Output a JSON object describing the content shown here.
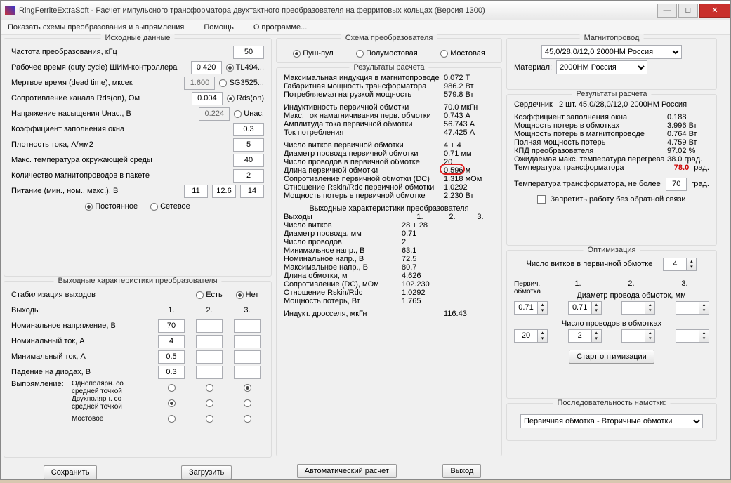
{
  "window": {
    "title": "RingFerriteExtraSoft - Расчет импульсного трансформатора двухтактного преобразователя на ферритовых кольцах (Версия 1300)",
    "min": "—",
    "max": "□",
    "close": "✕"
  },
  "menu": {
    "schemes": "Показать схемы преобразования и выпрямления",
    "help": "Помощь",
    "about": "О программе..."
  },
  "left": {
    "title": "Исходные данные",
    "freq_lbl": "Частота преобразования, кГц",
    "freq": "50",
    "duty_lbl": "Рабочее время (duty cycle) ШИМ-контроллера",
    "duty": "0.420",
    "tl494": "TL494...",
    "dead_lbl": "Мертвое время (dead time), мксек",
    "dead": "1.600",
    "sg": "SG3525...",
    "rds_lbl": "Сопротивление канала Rds(on), Ом",
    "rds": "0.004",
    "rdson": "Rds(on)",
    "usat_lbl": "Напряжение насыщения Uнас., В",
    "usat": "0.224",
    "unasc": "Uнас.",
    "kfill_lbl": "Коэффициент заполнения окна",
    "kfill": "0.3",
    "j_lbl": "Плотность тока, А/мм2",
    "j": "5",
    "tamb_lbl": "Макс. температура окружающей среды",
    "tamb": "40",
    "ncores_lbl": "Количество магнитопроводов в пакете",
    "ncores": "2",
    "supply_lbl": "Питание (мин., ном., макс.), В",
    "vmin": "11",
    "vnom": "12.6",
    "vmax": "14",
    "dc": "Постоянное",
    "ac": "Сетевое",
    "out_title": "Выходные характеристики преобразователя",
    "stab_lbl": "Стабилизация выходов",
    "yes": "Есть",
    "no": "Нет",
    "outs": "Выходы",
    "c1": "1.",
    "c2": "2.",
    "c3": "3.",
    "vn_lbl": "Номинальное напряжение, В",
    "vn1": "70",
    "in_lbl": "Номинальный ток, А",
    "in1": "4",
    "imin_lbl": "Минимальный ток, А",
    "imin1": "0.5",
    "vd_lbl": "Падение на диодах, В",
    "vd1": "0.3",
    "rect_lbl": "Выпрямление:",
    "r1": "Однополярн. со средней точкой",
    "r2": "Двухполярн. со средней точкой",
    "r3": "Мостовое",
    "save": "Сохранить",
    "load": "Загрузить"
  },
  "mid": {
    "conv_title": "Схема преобразователя",
    "push": "Пуш-пул",
    "half": "Полумостовая",
    "full": "Мостовая",
    "res_title": "Результаты расчета",
    "rows1": [
      [
        "Максимальная индукция в магнитопроводе",
        "0.072 Т"
      ],
      [
        "Габаритная мощность трансформатора",
        "986.2 Вт"
      ],
      [
        "Потребляемая нагрузкой мощность",
        "579.8 Вт"
      ]
    ],
    "rows2": [
      [
        "Индуктивность первичной обмотки",
        "70.0 мкГн"
      ],
      [
        "Макс. ток намагничивания перв. обмотки",
        "0.743 А"
      ],
      [
        "Амплитуда тока первичной обмотки",
        "56.743 А"
      ],
      [
        "Ток потребления",
        "47.425 А"
      ]
    ],
    "rows3": [
      [
        "Число витков первичной обмотки",
        "4 + 4"
      ],
      [
        "Диаметр провода первичной обмотки",
        "0.71 мм"
      ],
      [
        "Число проводов в первичной обмотке",
        "20"
      ],
      [
        "Длина первичной обмотки",
        "0.596 м"
      ],
      [
        "Сопротивление первичной обмотки (DC)",
        "1.318 мОм"
      ],
      [
        "Отношение Rskin/Rdc первичной обмотки",
        "1.0292"
      ],
      [
        "Мощность потерь в первичной обмотке",
        "2.230 Вт"
      ]
    ],
    "out_title": "Выходные характеристики преобразователя",
    "outhdr": [
      "Выходы",
      "1.",
      "2.",
      "3."
    ],
    "outrows": [
      [
        "Число витков",
        "28 + 28"
      ],
      [
        "Диаметр провода, мм",
        "0.71"
      ],
      [
        "Число проводов",
        "2"
      ],
      [
        "Минимальное напр., В",
        "63.1"
      ],
      [
        "Номинальное напр., В",
        "72.5"
      ],
      [
        "Максимальное напр., В",
        "80.7"
      ],
      [
        "Длина обмотки, м",
        "4.626"
      ],
      [
        "Сопротивление (DC), мОм",
        "102.230"
      ],
      [
        "Отношение Rskin/Rdc",
        "1.0292"
      ],
      [
        "Мощность потерь, Вт",
        "1.765"
      ]
    ],
    "choke": [
      "Индукт. дросселя, мкГн",
      "116.43"
    ],
    "auto": "Автоматический расчет",
    "exit": "Выход"
  },
  "right": {
    "core_title": "Магнитопровод",
    "core_sel": "45,0/28,0/12,0 2000НМ Россия",
    "mat_lbl": "Материал:",
    "mat_sel": "2000НМ Россия",
    "res_title": "Результаты расчета",
    "core_k": "Сердечник",
    "core_v": "2 шт. 45,0/28,0/12,0 2000НМ Россия",
    "rows": [
      [
        "Коэффициент заполнения окна",
        "0.188"
      ],
      [
        "Мощность потерь в обмотках",
        "3.996 Вт"
      ],
      [
        "Мощность потерь в магнитопроводе",
        "0.764 Вт"
      ],
      [
        "Полная мощность потерь",
        "4.759 Вт"
      ],
      [
        "КПД преобразователя",
        "97.02 %"
      ],
      [
        "Ожидаемая макс. температура перегрева",
        "38.0 град."
      ]
    ],
    "ttrans_k": "Температура трансформатора",
    "ttrans_v": "78.0",
    "ttrans_u": "град.",
    "tlim_k": "Температура трансформатора, не более",
    "tlim": "70",
    "tlim_u": "град.",
    "nofdbk": "Запретить работу без обратной связи",
    "opt_title": "Оптимизация",
    "nturns_lbl": "Число витков в первичной обмотке",
    "nturns": "4",
    "prim": "Первич. обмотка",
    "c1": "1.",
    "c2": "2.",
    "c3": "3.",
    "diam_lbl": "Диаметр провода обмоток, мм",
    "d0": "0.71",
    "d1": "0.71",
    "nw_lbl": "Число проводов в обмотках",
    "nw0": "20",
    "nw1": "2",
    "start": "Старт оптимизации",
    "seq_title": "Последовательность намотки:",
    "seq_sel": "Первичная обмотка - Вторичные обмотки"
  }
}
